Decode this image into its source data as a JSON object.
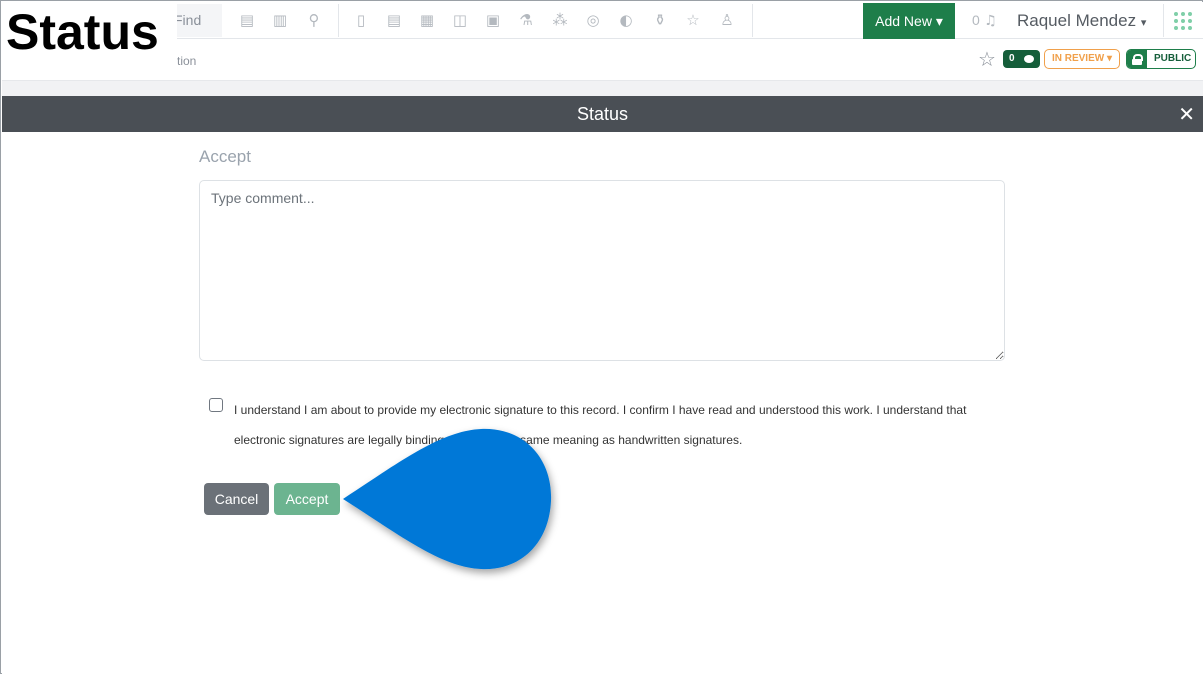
{
  "caption": "Status",
  "nav": {
    "find_label": "Find",
    "add_new_label": "Add New",
    "notification_count": "0",
    "user_name": "Raquel Mendez",
    "icons": [
      "dashboard-icon",
      "chart-icon",
      "search-icon",
      "notebook-icon",
      "clipboard-icon",
      "calendar-icon",
      "presentation-icon",
      "checklist-icon",
      "lab-icon",
      "network-icon",
      "target-icon",
      "shield-icon",
      "flask-icon",
      "star-icon",
      "people-icon",
      "bell-icon",
      "apps-grid-icon"
    ]
  },
  "subbar": {
    "breadcrumb": "tion",
    "comment_count": "0",
    "status_label": "IN REVIEW",
    "visibility_label": "PUBLIC"
  },
  "modal": {
    "title": "Status",
    "close_glyph": "✕",
    "heading": "Accept",
    "comment_placeholder": "Type comment...",
    "consent_line1": "I understand I am about to provide my electronic signature to this record. I confirm I have read and understood this work. I understand that",
    "consent_line2": "electronic signatures are legally binding and have the same meaning as handwritten signatures.",
    "cancel_label": "Cancel",
    "accept_label": "Accept"
  },
  "colors": {
    "brand_green": "#1e7e4a",
    "header_gray": "#4a4f55",
    "accept_green": "#6cb490",
    "cancel_gray": "#6b7178",
    "review_orange": "#f0a04b",
    "pointer_blue": "#0078d7"
  }
}
